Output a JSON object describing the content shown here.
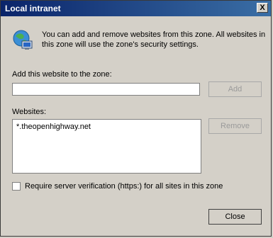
{
  "window": {
    "title": "Local intranet",
    "close_glyph": "X"
  },
  "description": "You can add and remove websites from this zone. All websites in this zone will use the zone's security settings.",
  "add_section": {
    "label": "Add this website to the zone:",
    "input_value": "",
    "add_button": "Add"
  },
  "websites": {
    "label": "Websites:",
    "items": [
      "*.theopenhighway.net"
    ],
    "remove_button": "Remove"
  },
  "verification": {
    "checked": false,
    "label": "Require server verification (https:) for all sites in this zone"
  },
  "footer": {
    "close_button": "Close"
  },
  "icons": {
    "zone": "globe-network-icon",
    "close": "close-icon"
  }
}
